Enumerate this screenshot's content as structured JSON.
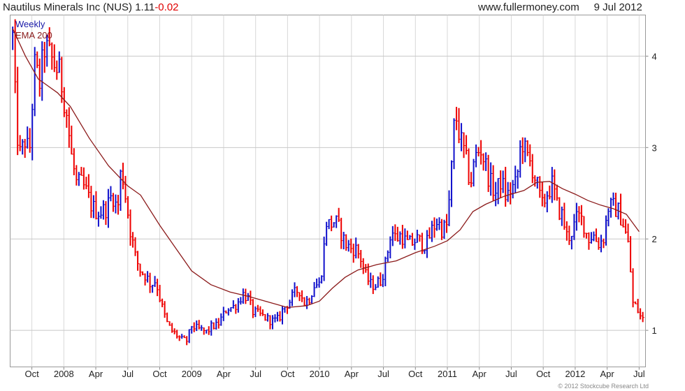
{
  "header": {
    "name": "Nautilus Minerals Inc (NUS)",
    "price": "1.11",
    "change": "-0.02",
    "source": "www.fullermoney.com",
    "date": "9 Jul 2012"
  },
  "legend": {
    "weekly": "Weekly",
    "ema": "EMA 200"
  },
  "copyright": "© 2012 Stockcube Research Ltd",
  "colors": {
    "up": "#1111cc",
    "down": "#ee0000",
    "ema": "#8b1a1a",
    "grid": "#d8d8d8",
    "axis": "#888888"
  },
  "chart_data": {
    "type": "line",
    "subtype": "weekly high-low bars colored by direction with EMA overlay",
    "ylim": [
      0.6,
      4.45
    ],
    "yticks": [
      1,
      2,
      3,
      4
    ],
    "y_axis_side": "right",
    "x_range": [
      2007.58,
      2012.55
    ],
    "xticks": [
      {
        "label": "Oct",
        "x": 2007.75
      },
      {
        "label": "2008",
        "x": 2008.0
      },
      {
        "label": "Apr",
        "x": 2008.25
      },
      {
        "label": "Jul",
        "x": 2008.5
      },
      {
        "label": "Oct",
        "x": 2008.75
      },
      {
        "label": "2009",
        "x": 2009.0
      },
      {
        "label": "Apr",
        "x": 2009.25
      },
      {
        "label": "Jul",
        "x": 2009.5
      },
      {
        "label": "Oct",
        "x": 2009.75
      },
      {
        "label": "2010",
        "x": 2010.0
      },
      {
        "label": "Apr",
        "x": 2010.25
      },
      {
        "label": "Jul",
        "x": 2010.5
      },
      {
        "label": "Oct",
        "x": 2010.75
      },
      {
        "label": "2011",
        "x": 2011.0
      },
      {
        "label": "Apr",
        "x": 2011.25
      },
      {
        "label": "Jul",
        "x": 2011.5
      },
      {
        "label": "Oct",
        "x": 2011.75
      },
      {
        "label": "2012",
        "x": 2012.0
      },
      {
        "label": "Apr",
        "x": 2012.25
      },
      {
        "label": "Jul",
        "x": 2012.5
      }
    ],
    "grid": true,
    "series": [
      {
        "name": "Weekly",
        "anchors": [
          [
            2007.6,
            4.2
          ],
          [
            2007.63,
            3.2
          ],
          [
            2007.66,
            2.9
          ],
          [
            2007.7,
            3.1
          ],
          [
            2007.73,
            2.9
          ],
          [
            2007.77,
            3.9
          ],
          [
            2007.81,
            3.7
          ],
          [
            2007.85,
            4.1
          ],
          [
            2007.89,
            4.0
          ],
          [
            2007.93,
            3.9
          ],
          [
            2007.97,
            3.8
          ],
          [
            2008.02,
            3.4
          ],
          [
            2008.06,
            2.9
          ],
          [
            2008.1,
            2.6
          ],
          [
            2008.14,
            2.6
          ],
          [
            2008.18,
            2.5
          ],
          [
            2008.22,
            2.35
          ],
          [
            2008.26,
            2.3
          ],
          [
            2008.3,
            2.3
          ],
          [
            2008.34,
            2.35
          ],
          [
            2008.38,
            2.5
          ],
          [
            2008.42,
            2.3
          ],
          [
            2008.45,
            2.8
          ],
          [
            2008.48,
            2.5
          ],
          [
            2008.52,
            2.1
          ],
          [
            2008.56,
            1.8
          ],
          [
            2008.6,
            1.65
          ],
          [
            2008.64,
            1.6
          ],
          [
            2008.68,
            1.5
          ],
          [
            2008.72,
            1.55
          ],
          [
            2008.76,
            1.3
          ],
          [
            2008.8,
            1.1
          ],
          [
            2008.84,
            1.0
          ],
          [
            2008.88,
            0.95
          ],
          [
            2008.92,
            0.9
          ],
          [
            2008.96,
            0.88
          ],
          [
            2009.0,
            1.05
          ],
          [
            2009.04,
            1.02
          ],
          [
            2009.08,
            1.0
          ],
          [
            2009.12,
            0.98
          ],
          [
            2009.16,
            1.05
          ],
          [
            2009.2,
            1.05
          ],
          [
            2009.24,
            1.15
          ],
          [
            2009.28,
            1.25
          ],
          [
            2009.32,
            1.25
          ],
          [
            2009.36,
            1.3
          ],
          [
            2009.4,
            1.4
          ],
          [
            2009.44,
            1.35
          ],
          [
            2009.48,
            1.2
          ],
          [
            2009.52,
            1.18
          ],
          [
            2009.56,
            1.15
          ],
          [
            2009.6,
            1.12
          ],
          [
            2009.64,
            1.1
          ],
          [
            2009.68,
            1.12
          ],
          [
            2009.72,
            1.25
          ],
          [
            2009.76,
            1.3
          ],
          [
            2009.8,
            1.4
          ],
          [
            2009.84,
            1.45
          ],
          [
            2009.88,
            1.3
          ],
          [
            2009.92,
            1.35
          ],
          [
            2009.96,
            1.5
          ],
          [
            2010.0,
            1.5
          ],
          [
            2010.03,
            1.8
          ],
          [
            2010.05,
            2.2
          ],
          [
            2010.08,
            2.15
          ],
          [
            2010.12,
            2.2
          ],
          [
            2010.16,
            2.1
          ],
          [
            2010.2,
            1.95
          ],
          [
            2010.24,
            1.9
          ],
          [
            2010.28,
            1.9
          ],
          [
            2010.32,
            1.8
          ],
          [
            2010.36,
            1.6
          ],
          [
            2010.4,
            1.5
          ],
          [
            2010.44,
            1.5
          ],
          [
            2010.48,
            1.55
          ],
          [
            2010.52,
            1.75
          ],
          [
            2010.56,
            2.1
          ],
          [
            2010.6,
            2.0
          ],
          [
            2010.64,
            2.05
          ],
          [
            2010.68,
            1.95
          ],
          [
            2010.72,
            1.95
          ],
          [
            2010.76,
            2.0
          ],
          [
            2010.8,
            1.95
          ],
          [
            2010.84,
            1.95
          ],
          [
            2010.88,
            2.1
          ],
          [
            2010.92,
            2.2
          ],
          [
            2010.96,
            2.1
          ],
          [
            2011.0,
            2.15
          ],
          [
            2011.03,
            2.7
          ],
          [
            2011.06,
            3.4
          ],
          [
            2011.1,
            3.1
          ],
          [
            2011.14,
            2.9
          ],
          [
            2011.18,
            2.6
          ],
          [
            2011.22,
            2.9
          ],
          [
            2011.26,
            3.0
          ],
          [
            2011.3,
            2.8
          ],
          [
            2011.34,
            2.6
          ],
          [
            2011.38,
            2.5
          ],
          [
            2011.42,
            2.65
          ],
          [
            2011.46,
            2.45
          ],
          [
            2011.5,
            2.55
          ],
          [
            2011.54,
            2.6
          ],
          [
            2011.58,
            3.1
          ],
          [
            2011.62,
            2.9
          ],
          [
            2011.66,
            2.8
          ],
          [
            2011.7,
            2.6
          ],
          [
            2011.74,
            2.35
          ],
          [
            2011.78,
            2.5
          ],
          [
            2011.82,
            2.6
          ],
          [
            2011.86,
            2.35
          ],
          [
            2011.9,
            2.25
          ],
          [
            2011.94,
            2.0
          ],
          [
            2011.98,
            2.1
          ],
          [
            2012.02,
            2.25
          ],
          [
            2012.06,
            2.2
          ],
          [
            2012.1,
            2.0
          ],
          [
            2012.14,
            2.05
          ],
          [
            2012.18,
            1.95
          ],
          [
            2012.22,
            2.0
          ],
          [
            2012.26,
            2.35
          ],
          [
            2012.3,
            2.35
          ],
          [
            2012.34,
            2.3
          ],
          [
            2012.38,
            2.15
          ],
          [
            2012.42,
            1.9
          ],
          [
            2012.45,
            1.3
          ],
          [
            2012.48,
            1.25
          ],
          [
            2012.51,
            1.15
          ],
          [
            2012.54,
            1.11
          ]
        ]
      },
      {
        "name": "EMA 200",
        "points": [
          [
            2007.6,
            4.3
          ],
          [
            2007.7,
            4.0
          ],
          [
            2007.8,
            3.75
          ],
          [
            2007.95,
            3.6
          ],
          [
            2008.05,
            3.45
          ],
          [
            2008.2,
            3.1
          ],
          [
            2008.35,
            2.8
          ],
          [
            2008.5,
            2.58
          ],
          [
            2008.6,
            2.48
          ],
          [
            2008.75,
            2.15
          ],
          [
            2008.9,
            1.85
          ],
          [
            2009.0,
            1.65
          ],
          [
            2009.15,
            1.5
          ],
          [
            2009.3,
            1.42
          ],
          [
            2009.45,
            1.37
          ],
          [
            2009.6,
            1.31
          ],
          [
            2009.75,
            1.25
          ],
          [
            2009.9,
            1.27
          ],
          [
            2010.0,
            1.32
          ],
          [
            2010.1,
            1.46
          ],
          [
            2010.2,
            1.58
          ],
          [
            2010.3,
            1.66
          ],
          [
            2010.45,
            1.72
          ],
          [
            2010.6,
            1.76
          ],
          [
            2010.75,
            1.85
          ],
          [
            2010.9,
            1.92
          ],
          [
            2011.0,
            1.98
          ],
          [
            2011.1,
            2.1
          ],
          [
            2011.2,
            2.3
          ],
          [
            2011.3,
            2.38
          ],
          [
            2011.45,
            2.47
          ],
          [
            2011.6,
            2.53
          ],
          [
            2011.7,
            2.62
          ],
          [
            2011.8,
            2.63
          ],
          [
            2011.9,
            2.55
          ],
          [
            2012.0,
            2.49
          ],
          [
            2012.1,
            2.42
          ],
          [
            2012.2,
            2.37
          ],
          [
            2012.3,
            2.33
          ],
          [
            2012.4,
            2.27
          ],
          [
            2012.5,
            2.08
          ]
        ]
      }
    ]
  }
}
